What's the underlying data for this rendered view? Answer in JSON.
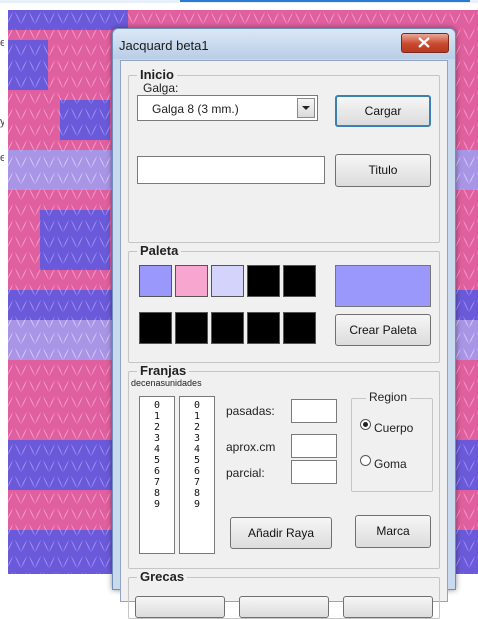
{
  "window": {
    "title": "Jacquard beta1"
  },
  "side_text": [
    "e",
    "y",
    "e"
  ],
  "inicio": {
    "legend": "Inicio",
    "galga_label": "Galga:",
    "galga_value": "Galga 8 (3 mm.)",
    "cargar_label": "Cargar",
    "titulo_value": "",
    "titulo_label": "Titulo"
  },
  "paleta": {
    "legend": "Paleta",
    "colors_row1": [
      "#9a98fb",
      "#f7a6cf",
      "#d3d3fb",
      "#000000",
      "#000000"
    ],
    "colors_row2": [
      "#000000",
      "#000000",
      "#000000",
      "#000000",
      "#000000"
    ],
    "preview_color": "#9a98fb",
    "crear_label": "Crear Paleta"
  },
  "franjas": {
    "legend": "Franjas",
    "decenas_label": "decenas",
    "unidades_label": "unidades",
    "decenas": [
      "0",
      "1",
      "2",
      "3",
      "4",
      "5",
      "6",
      "7",
      "8",
      "9"
    ],
    "unidades": [
      "0",
      "1",
      "2",
      "3",
      "4",
      "5",
      "6",
      "7",
      "8",
      "9"
    ],
    "pasadas_label": "pasadas:",
    "aprox_label": "aprox.cm",
    "parcial_label": "parcial:",
    "region_legend": "Region",
    "cuerpo_label": "Cuerpo",
    "goma_label": "Goma",
    "region_selected": "Cuerpo",
    "anadir_label": "Añadir Raya",
    "marca_label": "Marca"
  },
  "grecas": {
    "legend": "Grecas"
  },
  "knit_colors": {
    "pink": "#f07ab6",
    "blue": "#8b7cf0",
    "lavender": "#c8b4f0"
  }
}
